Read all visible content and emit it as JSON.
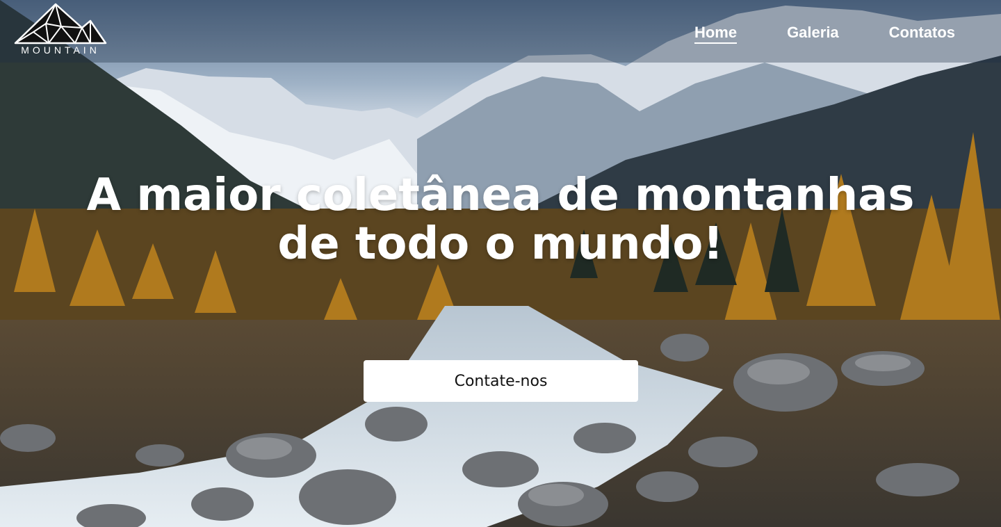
{
  "brand": {
    "logo_text": "MOUNTAIN"
  },
  "nav": {
    "items": [
      {
        "label": "Home",
        "active": true
      },
      {
        "label": "Galeria",
        "active": false
      },
      {
        "label": "Contatos",
        "active": false
      }
    ]
  },
  "hero": {
    "headline": "A maior coletânea de montanhas de todo o mundo!",
    "cta_label": "Contate-nos"
  },
  "colors": {
    "nav_text": "#ffffff",
    "button_bg": "#ffffff",
    "button_text": "#111111"
  }
}
